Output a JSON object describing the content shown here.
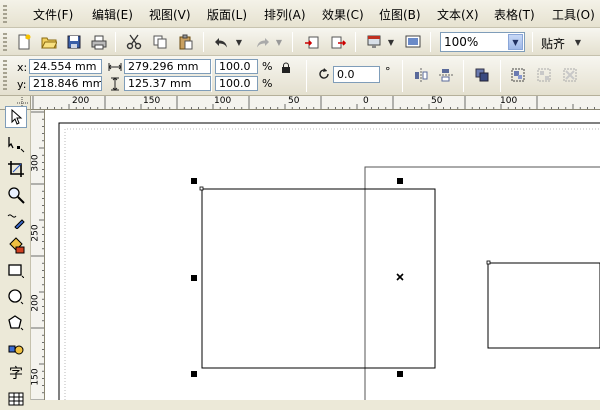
{
  "menu": [
    {
      "label": "文件(F)"
    },
    {
      "label": "编辑(E)"
    },
    {
      "label": "视图(V)"
    },
    {
      "label": "版面(L)"
    },
    {
      "label": "排列(A)"
    },
    {
      "label": "效果(C)"
    },
    {
      "label": "位图(B)"
    },
    {
      "label": "文本(X)"
    },
    {
      "label": "表格(T)"
    },
    {
      "label": "工具(O)"
    }
  ],
  "toolbar": {
    "zoom": "100%",
    "snap": "贴齐"
  },
  "property_bar": {
    "x_label": "x:",
    "x_value": "24.554 mm",
    "y_label": "y:",
    "y_value": "218.846 mm",
    "width_value": "279.296 mm",
    "height_value": "125.37 mm",
    "scale_w": "100.0",
    "scale_h": "100.0",
    "percent": "%",
    "rotation": "0.0",
    "degree": "°"
  },
  "rulers": {
    "horizontal_ticks": [
      "200",
      "150",
      "100",
      "50",
      "0",
      "50",
      "100"
    ],
    "vertical_ticks": [
      "300",
      "250",
      "200",
      "150"
    ]
  },
  "tools": [
    {
      "icon": "pick-tool-icon"
    },
    {
      "icon": "shape-tool-icon"
    },
    {
      "icon": "crop-tool-icon"
    },
    {
      "icon": "zoom-tool-icon"
    },
    {
      "icon": "freehand-tool-icon"
    },
    {
      "icon": "smart-fill-icon"
    },
    {
      "icon": "rectangle-tool-icon"
    },
    {
      "icon": "ellipse-tool-icon"
    },
    {
      "icon": "polygon-tool-icon"
    },
    {
      "icon": "basic-shapes-icon"
    },
    {
      "icon": "text-tool-icon",
      "label": "字"
    },
    {
      "icon": "table-tool-icon"
    }
  ],
  "colors": {
    "chrome": "#ece9d8",
    "field_border": "#7f9db9",
    "selection_handle": "#000000"
  }
}
